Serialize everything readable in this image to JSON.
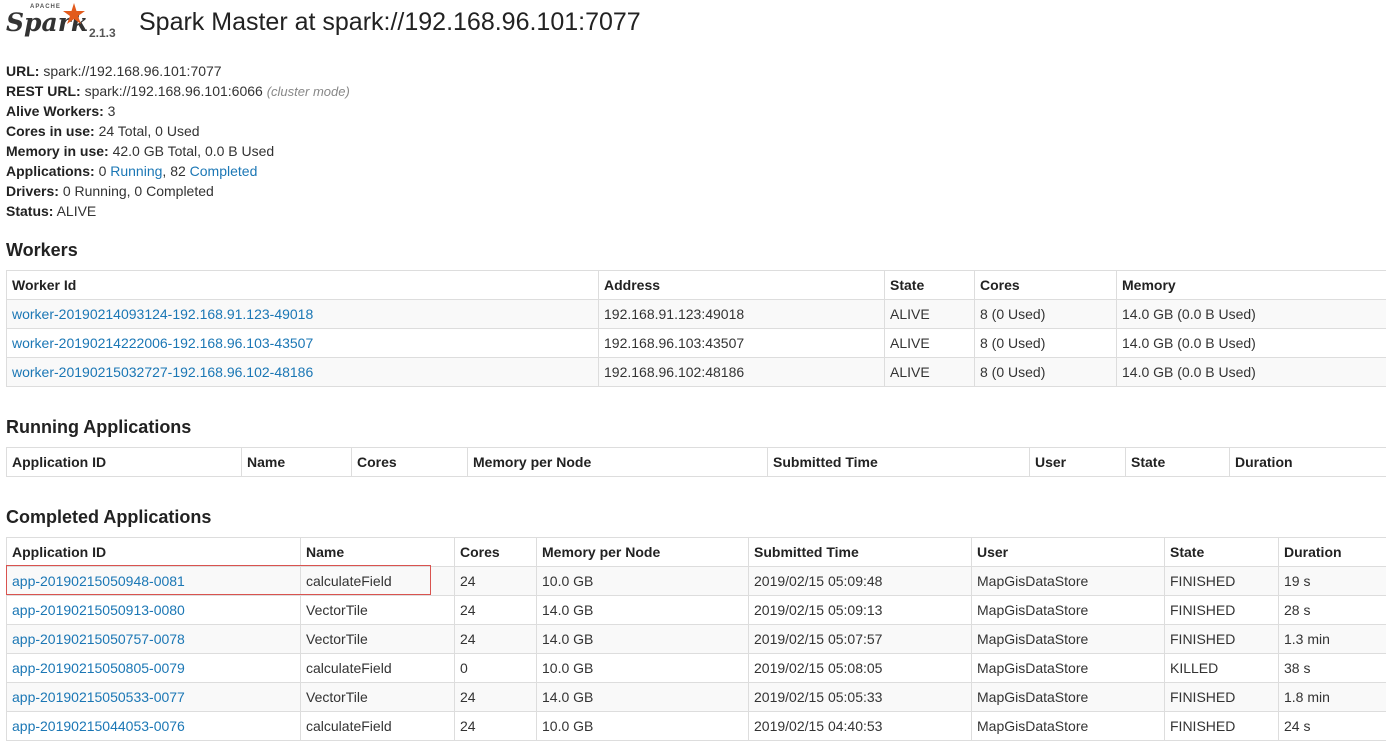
{
  "header": {
    "logo_apache": "APACHE",
    "logo_text": "Spark",
    "version": "2.1.3",
    "title": "Spark Master at spark://192.168.96.101:7077"
  },
  "info": {
    "url_label": "URL:",
    "url_value": "spark://192.168.96.101:7077",
    "rest_label": "REST URL:",
    "rest_value": "spark://192.168.96.101:6066",
    "rest_note": "(cluster mode)",
    "alive_label": "Alive Workers:",
    "alive_value": "3",
    "cores_label": "Cores in use:",
    "cores_value": "24 Total, 0 Used",
    "memory_label": "Memory in use:",
    "memory_value": "42.0 GB Total, 0.0 B Used",
    "apps_label": "Applications:",
    "apps_running_count": "0",
    "apps_running_link": "Running",
    "apps_completed_count": "82",
    "apps_completed_link": "Completed",
    "drivers_label": "Drivers:",
    "drivers_value": "0 Running, 0 Completed",
    "status_label": "Status:",
    "status_value": "ALIVE"
  },
  "workers": {
    "heading": "Workers",
    "columns": [
      "Worker Id",
      "Address",
      "State",
      "Cores",
      "Memory"
    ],
    "rows": [
      [
        "worker-20190214093124-192.168.91.123-49018",
        "192.168.91.123:49018",
        "ALIVE",
        "8 (0 Used)",
        "14.0 GB (0.0 B Used)"
      ],
      [
        "worker-20190214222006-192.168.96.103-43507",
        "192.168.96.103:43507",
        "ALIVE",
        "8 (0 Used)",
        "14.0 GB (0.0 B Used)"
      ],
      [
        "worker-20190215032727-192.168.96.102-48186",
        "192.168.96.102:48186",
        "ALIVE",
        "8 (0 Used)",
        "14.0 GB (0.0 B Used)"
      ]
    ]
  },
  "running": {
    "heading": "Running Applications",
    "columns": [
      "Application ID",
      "Name",
      "Cores",
      "Memory per Node",
      "Submitted Time",
      "User",
      "State",
      "Duration"
    ]
  },
  "completed": {
    "heading": "Completed Applications",
    "columns": [
      "Application ID",
      "Name",
      "Cores",
      "Memory per Node",
      "Submitted Time",
      "User",
      "State",
      "Duration"
    ],
    "rows": [
      [
        "app-20190215050948-0081",
        "calculateField",
        "24",
        "10.0 GB",
        "2019/02/15 05:09:48",
        "MapGisDataStore",
        "FINISHED",
        "19 s"
      ],
      [
        "app-20190215050913-0080",
        "VectorTile",
        "24",
        "14.0 GB",
        "2019/02/15 05:09:13",
        "MapGisDataStore",
        "FINISHED",
        "28 s"
      ],
      [
        "app-20190215050757-0078",
        "VectorTile",
        "24",
        "14.0 GB",
        "2019/02/15 05:07:57",
        "MapGisDataStore",
        "FINISHED",
        "1.3 min"
      ],
      [
        "app-20190215050805-0079",
        "calculateField",
        "0",
        "10.0 GB",
        "2019/02/15 05:08:05",
        "MapGisDataStore",
        "KILLED",
        "38 s"
      ],
      [
        "app-20190215050533-0077",
        "VectorTile",
        "24",
        "14.0 GB",
        "2019/02/15 05:05:33",
        "MapGisDataStore",
        "FINISHED",
        "1.8 min"
      ],
      [
        "app-20190215044053-0076",
        "calculateField",
        "24",
        "10.0 GB",
        "2019/02/15 04:40:53",
        "MapGisDataStore",
        "FINISHED",
        "24 s"
      ]
    ]
  },
  "colors": {
    "link": "#1b77b5",
    "highlight": "#d9534f",
    "logo_star": "#e25a1c"
  }
}
